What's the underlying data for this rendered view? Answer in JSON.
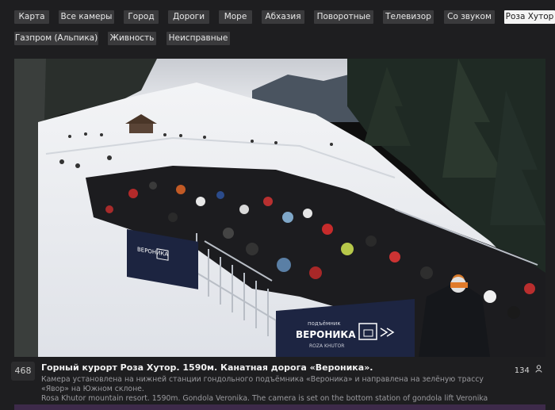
{
  "nav": {
    "row1": [
      "Карта",
      "Все камеры",
      "Город",
      "Дороги",
      "Море",
      "Абхазия",
      "Поворотные",
      "Телевизор",
      "Со звуком",
      "Роза Хутор"
    ],
    "row2": [
      "Газпром (Альпика)",
      "Живность",
      "Неисправные"
    ],
    "active": "Роза Хутор"
  },
  "video": {
    "banner_brand_top": "подъёмник",
    "banner_brand": "ВЕРОНИКА",
    "banner_sub": "ROZA KHUTOR",
    "banner_brand_small": "ВЕРОНИКА"
  },
  "info": {
    "badge": "468",
    "title": "Горный курорт Роза Хутор. 1590м. Канатная дорога «Вероника».",
    "desc_ru": "Камера установлена на нижней станции гондольного подъёмника «Вероника» и направлена на зелёную трассу «Явор» на Южном склоне.",
    "desc_en": "Rosa Khutor mountain resort. 1590m. Gondola Veronika. The camera is set on the bottom station of gondola lift Veronika",
    "viewers": "134"
  },
  "colors": {
    "accent_bar": "#3d2a4a",
    "chip_bg": "#3a3a3c",
    "chip_active_bg": "#f4f4f4"
  }
}
